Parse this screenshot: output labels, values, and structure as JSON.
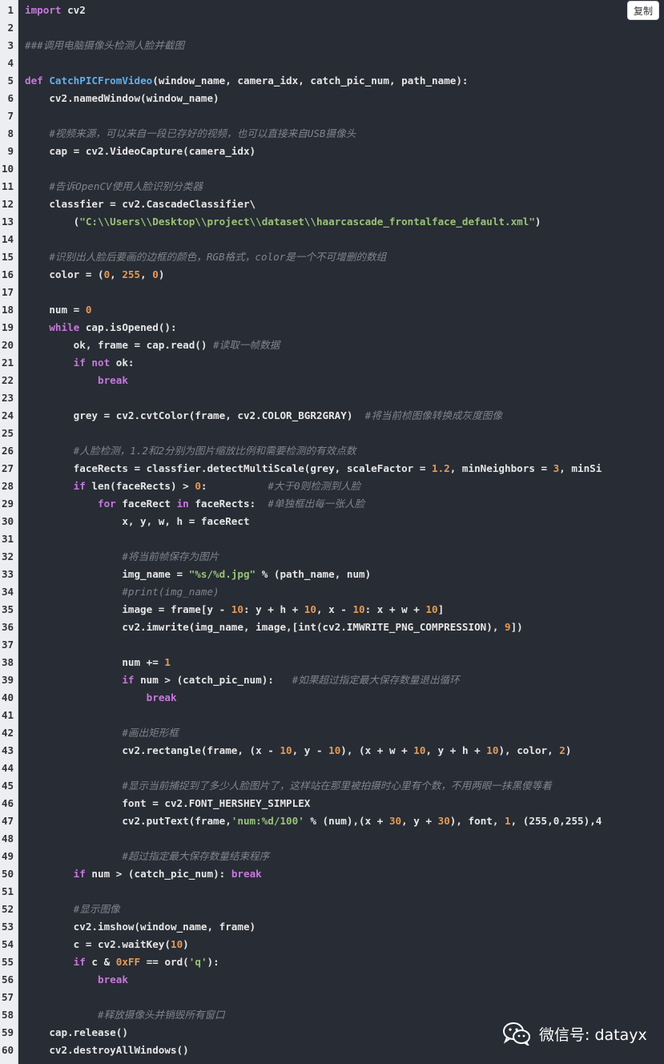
{
  "copy_button": {
    "label": "复制"
  },
  "watermark": {
    "text": "微信号: datayx",
    "icon": "wechat-icon"
  },
  "colors": {
    "background": "#282c34",
    "gutter": "#eceef1",
    "keyword": "#c678dd",
    "function": "#61afef",
    "string": "#98c379",
    "number": "#e59a54",
    "comment": "#7f848e",
    "text": "#e6e6e6"
  },
  "code_lines": [
    {
      "n": "1",
      "t": [
        [
          "kw",
          "import"
        ],
        [
          "tx",
          " cv2"
        ]
      ]
    },
    {
      "n": "2",
      "t": []
    },
    {
      "n": "3",
      "t": [
        [
          "cm",
          "###调用电脑摄像头检测人脸并截图"
        ]
      ]
    },
    {
      "n": "4",
      "t": []
    },
    {
      "n": "5",
      "t": [
        [
          "kw",
          "def "
        ],
        [
          "fn",
          "CatchPICFromVideo"
        ],
        [
          "tx",
          "(window_name, camera_idx, catch_pic_num, path_name):"
        ]
      ]
    },
    {
      "n": "6",
      "t": [
        [
          "tx",
          "    cv2.namedWindow(window_name)"
        ]
      ]
    },
    {
      "n": "7",
      "t": []
    },
    {
      "n": "8",
      "t": [
        [
          "tx",
          "    "
        ],
        [
          "cm",
          "#视频来源，可以来自一段已存好的视频，也可以直接来自USB摄像头"
        ]
      ]
    },
    {
      "n": "9",
      "t": [
        [
          "tx",
          "    cap = cv2.VideoCapture(camera_idx)"
        ]
      ]
    },
    {
      "n": "10",
      "t": []
    },
    {
      "n": "11",
      "t": [
        [
          "tx",
          "    "
        ],
        [
          "cm",
          "#告诉OpenCV使用人脸识别分类器"
        ]
      ]
    },
    {
      "n": "12",
      "t": [
        [
          "tx",
          "    classfier = cv2.CascadeClassifier\\"
        ]
      ]
    },
    {
      "n": "13",
      "t": [
        [
          "tx",
          "        ("
        ],
        [
          "str",
          "\"C:\\\\Users\\\\Desktop\\\\project\\\\dataset\\\\haarcascade_frontalface_default.xml\""
        ],
        [
          "tx",
          ")"
        ]
      ]
    },
    {
      "n": "14",
      "t": []
    },
    {
      "n": "15",
      "t": [
        [
          "tx",
          "    "
        ],
        [
          "cm",
          "#识别出人脸后要画的边框的颜色，RGB格式，color是一个不可增删的数组"
        ]
      ]
    },
    {
      "n": "16",
      "t": [
        [
          "tx",
          "    color = ("
        ],
        [
          "num",
          "0"
        ],
        [
          "tx",
          ", "
        ],
        [
          "num",
          "255"
        ],
        [
          "tx",
          ", "
        ],
        [
          "num",
          "0"
        ],
        [
          "tx",
          ")"
        ]
      ]
    },
    {
      "n": "17",
      "t": []
    },
    {
      "n": "18",
      "t": [
        [
          "tx",
          "    num = "
        ],
        [
          "num",
          "0"
        ]
      ]
    },
    {
      "n": "19",
      "t": [
        [
          "tx",
          "    "
        ],
        [
          "kw",
          "while"
        ],
        [
          "tx",
          " cap.isOpened():"
        ]
      ]
    },
    {
      "n": "20",
      "t": [
        [
          "tx",
          "        ok, frame = cap.read() "
        ],
        [
          "cm",
          "#读取一帧数据"
        ]
      ]
    },
    {
      "n": "21",
      "t": [
        [
          "tx",
          "        "
        ],
        [
          "kw",
          "if not"
        ],
        [
          "tx",
          " ok:"
        ]
      ]
    },
    {
      "n": "22",
      "t": [
        [
          "tx",
          "            "
        ],
        [
          "kw",
          "break"
        ]
      ]
    },
    {
      "n": "23",
      "t": []
    },
    {
      "n": "24",
      "t": [
        [
          "tx",
          "        grey = cv2.cvtColor(frame, cv2.COLOR_BGR2GRAY)  "
        ],
        [
          "cm",
          "#将当前桢图像转换成灰度图像"
        ]
      ]
    },
    {
      "n": "25",
      "t": []
    },
    {
      "n": "26",
      "t": [
        [
          "tx",
          "        "
        ],
        [
          "cm",
          "#人脸检测，1.2和2分别为图片缩放比例和需要检测的有效点数"
        ]
      ]
    },
    {
      "n": "27",
      "t": [
        [
          "tx",
          "        faceRects = classfier.detectMultiScale(grey, scaleFactor = "
        ],
        [
          "num",
          "1.2"
        ],
        [
          "tx",
          ", minNeighbors = "
        ],
        [
          "num",
          "3"
        ],
        [
          "tx",
          ", minSi"
        ]
      ]
    },
    {
      "n": "28",
      "t": [
        [
          "tx",
          "        "
        ],
        [
          "kw",
          "if"
        ],
        [
          "tx",
          " len(faceRects) > "
        ],
        [
          "num",
          "0"
        ],
        [
          "tx",
          ":          "
        ],
        [
          "cm",
          "#大于0则检测到人脸"
        ]
      ]
    },
    {
      "n": "29",
      "t": [
        [
          "tx",
          "            "
        ],
        [
          "kw",
          "for"
        ],
        [
          "tx",
          " faceRect "
        ],
        [
          "kw",
          "in"
        ],
        [
          "tx",
          " faceRects:  "
        ],
        [
          "cm",
          "#单独框出每一张人脸"
        ]
      ]
    },
    {
      "n": "30",
      "t": [
        [
          "tx",
          "                x, y, w, h = faceRect"
        ]
      ]
    },
    {
      "n": "31",
      "t": []
    },
    {
      "n": "32",
      "t": [
        [
          "tx",
          "                "
        ],
        [
          "cm",
          "#将当前帧保存为图片"
        ]
      ]
    },
    {
      "n": "33",
      "t": [
        [
          "tx",
          "                img_name = "
        ],
        [
          "str",
          "\"%s/%d.jpg\""
        ],
        [
          "tx",
          " % (path_name, num)"
        ]
      ]
    },
    {
      "n": "34",
      "t": [
        [
          "tx",
          "                "
        ],
        [
          "cm",
          "#print(img_name)"
        ]
      ]
    },
    {
      "n": "35",
      "t": [
        [
          "tx",
          "                image = frame[y - "
        ],
        [
          "num",
          "10"
        ],
        [
          "tx",
          ": y + h + "
        ],
        [
          "num",
          "10"
        ],
        [
          "tx",
          ", x - "
        ],
        [
          "num",
          "10"
        ],
        [
          "tx",
          ": x + w + "
        ],
        [
          "num",
          "10"
        ],
        [
          "tx",
          "]"
        ]
      ]
    },
    {
      "n": "36",
      "t": [
        [
          "tx",
          "                cv2.imwrite(img_name, image,[int(cv2.IMWRITE_PNG_COMPRESSION), "
        ],
        [
          "num",
          "9"
        ],
        [
          "tx",
          "])"
        ]
      ]
    },
    {
      "n": "37",
      "t": []
    },
    {
      "n": "38",
      "t": [
        [
          "tx",
          "                num += "
        ],
        [
          "num",
          "1"
        ]
      ]
    },
    {
      "n": "39",
      "t": [
        [
          "tx",
          "                "
        ],
        [
          "kw",
          "if"
        ],
        [
          "tx",
          " num > (catch_pic_num):   "
        ],
        [
          "cm",
          "#如果超过指定最大保存数量退出循环"
        ]
      ]
    },
    {
      "n": "40",
      "t": [
        [
          "tx",
          "                    "
        ],
        [
          "kw",
          "break"
        ]
      ]
    },
    {
      "n": "41",
      "t": []
    },
    {
      "n": "42",
      "t": [
        [
          "tx",
          "                "
        ],
        [
          "cm",
          "#画出矩形框"
        ]
      ]
    },
    {
      "n": "43",
      "t": [
        [
          "tx",
          "                cv2.rectangle(frame, (x - "
        ],
        [
          "num",
          "10"
        ],
        [
          "tx",
          ", y - "
        ],
        [
          "num",
          "10"
        ],
        [
          "tx",
          "), (x + w + "
        ],
        [
          "num",
          "10"
        ],
        [
          "tx",
          ", y + h + "
        ],
        [
          "num",
          "10"
        ],
        [
          "tx",
          "), color, "
        ],
        [
          "num",
          "2"
        ],
        [
          "tx",
          ")"
        ]
      ]
    },
    {
      "n": "44",
      "t": []
    },
    {
      "n": "45",
      "t": [
        [
          "tx",
          "                "
        ],
        [
          "cm",
          "#显示当前捕捉到了多少人脸图片了，这样站在那里被拍摄时心里有个数，不用两眼一抹黑傻等着"
        ]
      ]
    },
    {
      "n": "46",
      "t": [
        [
          "tx",
          "                font = cv2.FONT_HERSHEY_SIMPLEX"
        ]
      ]
    },
    {
      "n": "47",
      "t": [
        [
          "tx",
          "                cv2.putText(frame,"
        ],
        [
          "str",
          "'num:%d/100'"
        ],
        [
          "tx",
          " % (num),(x + "
        ],
        [
          "num",
          "30"
        ],
        [
          "tx",
          ", y + "
        ],
        [
          "num",
          "30"
        ],
        [
          "tx",
          "), font, "
        ],
        [
          "num",
          "1"
        ],
        [
          "tx",
          ", (255,0,255),4"
        ]
      ]
    },
    {
      "n": "48",
      "t": []
    },
    {
      "n": "49",
      "t": [
        [
          "tx",
          "                "
        ],
        [
          "cm",
          "#超过指定最大保存数量结束程序"
        ]
      ]
    },
    {
      "n": "50",
      "t": [
        [
          "tx",
          "        "
        ],
        [
          "kw",
          "if"
        ],
        [
          "tx",
          " num > (catch_pic_num): "
        ],
        [
          "kw",
          "break"
        ]
      ]
    },
    {
      "n": "51",
      "t": []
    },
    {
      "n": "52",
      "t": [
        [
          "tx",
          "        "
        ],
        [
          "cm",
          "#显示图像"
        ]
      ]
    },
    {
      "n": "53",
      "t": [
        [
          "tx",
          "        cv2.imshow(window_name, frame)"
        ]
      ]
    },
    {
      "n": "54",
      "t": [
        [
          "tx",
          "        c = cv2.waitKey("
        ],
        [
          "num",
          "10"
        ],
        [
          "tx",
          ")"
        ]
      ]
    },
    {
      "n": "55",
      "t": [
        [
          "tx",
          "        "
        ],
        [
          "kw",
          "if"
        ],
        [
          "tx",
          " c & "
        ],
        [
          "num",
          "0xFF"
        ],
        [
          "tx",
          " == ord("
        ],
        [
          "str",
          "'q'"
        ],
        [
          "tx",
          "):"
        ]
      ]
    },
    {
      "n": "56",
      "t": [
        [
          "tx",
          "            "
        ],
        [
          "kw",
          "break"
        ]
      ]
    },
    {
      "n": "57",
      "t": []
    },
    {
      "n": "58",
      "t": [
        [
          "tx",
          "            "
        ],
        [
          "cm",
          "#释放摄像头并销毁所有窗口"
        ]
      ]
    },
    {
      "n": "59",
      "t": [
        [
          "tx",
          "    cap.release()"
        ]
      ]
    },
    {
      "n": "60",
      "t": [
        [
          "tx",
          "    cv2.destroyAllWindows()"
        ]
      ]
    }
  ]
}
